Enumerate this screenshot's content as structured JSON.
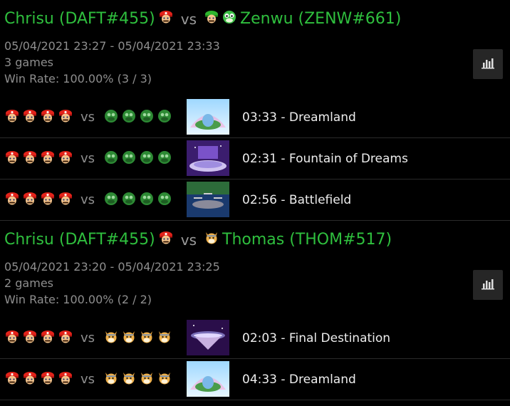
{
  "sets": [
    {
      "player1": {
        "name": "Chrisu (DAFT#455)",
        "characters": [
          "mario-icon"
        ]
      },
      "vs_label": "vs",
      "player2": {
        "name": "Zenwu (ZENW#661)",
        "characters": [
          "luigi-icon",
          "yoshi-icon"
        ]
      },
      "date_range": "05/04/2021 23:27 - 05/04/2021 23:33",
      "games_count": "3 games",
      "win_rate": "Win Rate: 100.00% (3 / 3)",
      "stats_icon": "bar-chart-icon",
      "games": [
        {
          "p1_stocks": [
            1,
            1,
            1,
            0
          ],
          "p2_stocks": [
            0,
            0,
            0,
            0
          ],
          "p2_char": "green",
          "stage": "dreamland",
          "text": "03:33 - Dreamland"
        },
        {
          "p1_stocks": [
            1,
            1,
            1,
            1
          ],
          "p2_stocks": [
            0,
            0,
            0,
            0
          ],
          "p2_char": "green",
          "stage": "fountain",
          "text": "02:31 - Fountain of Dreams"
        },
        {
          "p1_stocks": [
            1,
            0,
            0,
            0
          ],
          "p2_stocks": [
            0,
            0,
            0,
            0
          ],
          "p2_char": "green",
          "stage": "battlefield",
          "text": "02:56 - Battlefield"
        }
      ]
    },
    {
      "player1": {
        "name": "Chrisu (DAFT#455)",
        "characters": [
          "mario-icon"
        ]
      },
      "vs_label": "vs",
      "player2": {
        "name": "Thomas (THOM#517)",
        "characters": [
          "fox-icon"
        ]
      },
      "date_range": "05/04/2021 23:20 - 05/04/2021 23:25",
      "games_count": "2 games",
      "win_rate": "Win Rate: 100.00% (2 / 2)",
      "stats_icon": "bar-chart-icon",
      "games": [
        {
          "p1_stocks": [
            1,
            1,
            1,
            0
          ],
          "p2_stocks": [
            1,
            1,
            0,
            0
          ],
          "p2_char": "fox",
          "stage": "final",
          "text": "02:03 - Final Destination"
        },
        {
          "p1_stocks": [
            1,
            0,
            0,
            0
          ],
          "p2_stocks": [
            0,
            0,
            0,
            0
          ],
          "p2_char": "fox",
          "stage": "dreamland",
          "text": "04:33 - Dreamland"
        }
      ]
    }
  ],
  "colors": {
    "player_name": "#2fbf3e",
    "muted": "#8e8e8e",
    "background": "#000000"
  }
}
